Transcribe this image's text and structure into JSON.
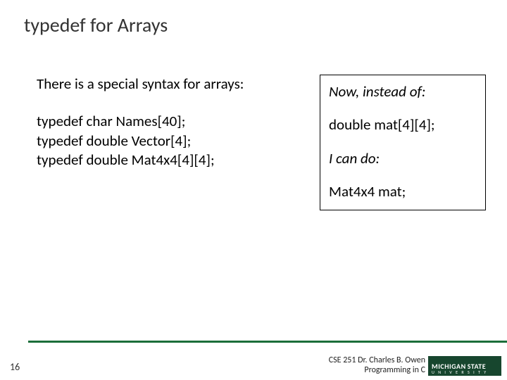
{
  "title": "typedef for Arrays",
  "left": {
    "intro": "There is a special syntax for arrays:",
    "code1": "typedef char Names[40];",
    "code2": "typedef double Vector[4];",
    "code3": "typedef double Mat4x4[4][4];"
  },
  "box": {
    "line1": "Now, instead of:",
    "line2": "double mat[4][4];",
    "line3": "I can do:",
    "line4": "Mat4x4 mat;"
  },
  "footer": {
    "page": "16",
    "credit1": "CSE 251 Dr. Charles B. Owen",
    "credit2": "Programming in C",
    "logo_top1": "MICHIGAN",
    "logo_top2": "STATE",
    "logo_bottom": "U N I V E R S I T Y"
  }
}
